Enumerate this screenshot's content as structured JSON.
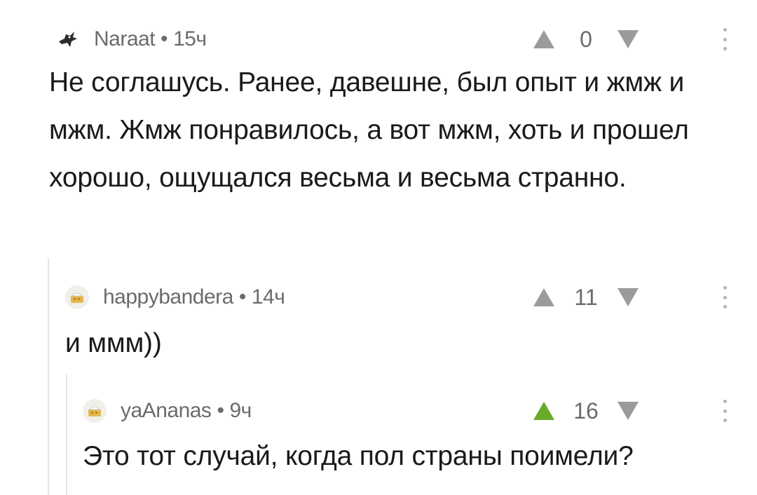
{
  "colors": {
    "text": "#1a1a1a",
    "meta": "#6b6b6b",
    "vote_neutral": "#9b9b9b",
    "vote_up_active": "#6aaa2a",
    "thread_line": "#e6e6e6"
  },
  "comments": [
    {
      "author": "Naraat",
      "separator": "•",
      "time": "15ч",
      "rating": "0",
      "avatar_icon": "bird-avatar-icon",
      "text": "Не соглашусь. Ранее, давешне, был опыт и жмж и мжм. Жмж понравилось, а вот мжм, хоть и прошел хорошо, ощущался весьма и весьма странно.",
      "upvoted": false
    },
    {
      "author": "happybandera",
      "separator": "•",
      "time": "14ч",
      "rating": "11",
      "avatar_icon": "default-avatar-icon",
      "text": "и ммм))",
      "upvoted": false
    },
    {
      "author": "yaAnanas",
      "separator": "•",
      "time": "9ч",
      "rating": "16",
      "avatar_icon": "default-avatar-icon",
      "text": "Это тот случай, когда пол страны поимели?",
      "upvoted": true
    }
  ]
}
